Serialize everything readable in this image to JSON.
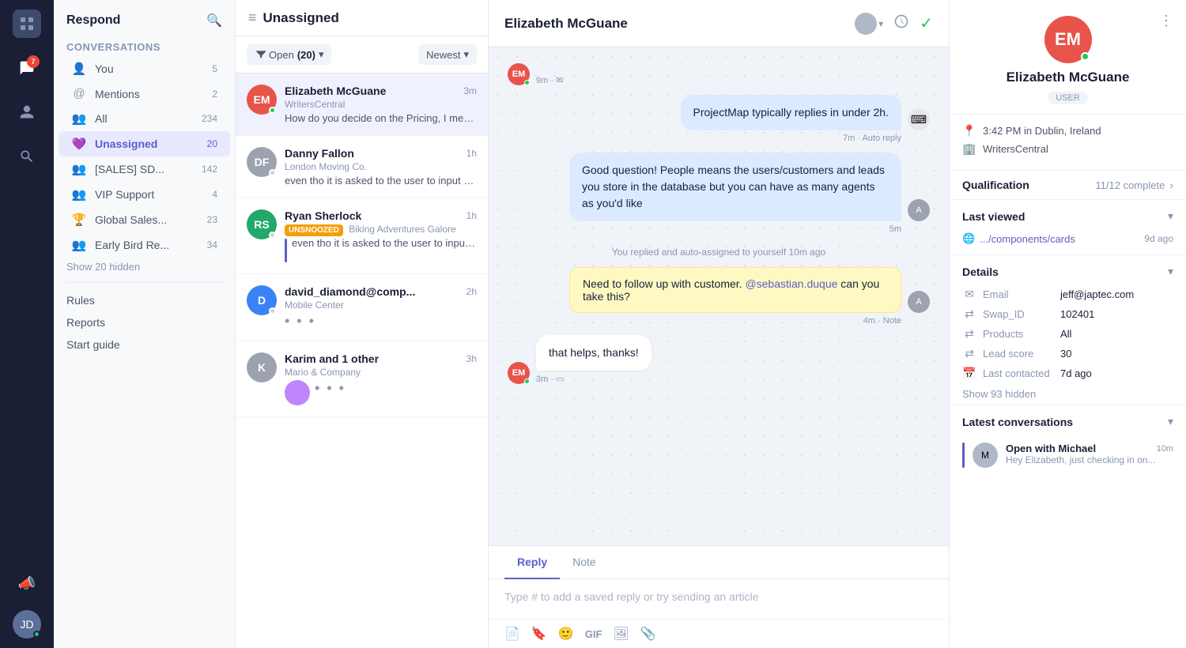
{
  "app": {
    "title": "Respond"
  },
  "leftNav": {
    "logo_icon": "⊞",
    "items": [
      {
        "id": "home",
        "icon": "⊞",
        "label": "Home"
      },
      {
        "id": "conversations",
        "icon": "💬",
        "label": "Conversations",
        "active": true
      },
      {
        "id": "contacts",
        "icon": "👤",
        "label": "Contacts"
      },
      {
        "id": "reports",
        "icon": "🔍",
        "label": "Reports"
      }
    ],
    "badge_count": "7",
    "bottom": {
      "megaphone_icon": "📣",
      "avatar_initials": "JD"
    }
  },
  "sidebar": {
    "title": "Respond",
    "section_label": "Conversations",
    "items": [
      {
        "id": "you",
        "icon": "👤",
        "label": "You",
        "count": "5"
      },
      {
        "id": "mentions",
        "icon": "@",
        "label": "Mentions",
        "count": "2"
      },
      {
        "id": "all",
        "icon": "👥",
        "label": "All",
        "count": "234"
      },
      {
        "id": "unassigned",
        "icon": "💜",
        "label": "Unassigned",
        "count": "20",
        "active": true
      },
      {
        "id": "sales",
        "icon": "👥",
        "label": "[SALES] SD...",
        "count": "142"
      },
      {
        "id": "vip",
        "icon": "👥",
        "label": "VIP Support",
        "count": "4"
      },
      {
        "id": "global",
        "icon": "🏆",
        "label": "Global Sales...",
        "count": "23"
      },
      {
        "id": "earlybird",
        "icon": "👥",
        "label": "Early Bird Re...",
        "count": "34"
      }
    ],
    "show_hidden": "Show 20 hidden",
    "links": [
      {
        "id": "rules",
        "label": "Rules"
      },
      {
        "id": "reports",
        "label": "Reports"
      },
      {
        "id": "start_guide",
        "label": "Start guide"
      }
    ]
  },
  "convList": {
    "title": "Unassigned",
    "filter": {
      "status": "Open",
      "count": "20",
      "sort": "Newest"
    },
    "items": [
      {
        "id": "em",
        "initials": "EM",
        "bg_color": "#e8534a",
        "name": "Elizabeth McGuane",
        "sub": "WritersCentral",
        "preview": "How do you decide on the Pricing, I mean what is your definition of People? When...",
        "time": "3m",
        "online": true,
        "active": true
      },
      {
        "id": "df",
        "initials": "DF",
        "bg_color": "#8896b3",
        "name": "Danny Fallon",
        "sub": "London Moving Co.",
        "preview": "even tho it is asked to the user to input on one line, can we show more lines of text...",
        "time": "1h",
        "online": false,
        "active": false
      },
      {
        "id": "rs",
        "initials": "RS",
        "bg_color": "#22a869",
        "name": "Ryan Sherlock",
        "sub": "Biking Adventures Galore",
        "preview": "even tho it is asked to the user to input on one line, can we show...",
        "time": "1h",
        "badge": "UNSNOOZED",
        "online": false,
        "active": false
      },
      {
        "id": "dd",
        "initials": "D",
        "bg_color": "#3b82f6",
        "name": "david_diamond@comp...",
        "sub": "Mobile Center",
        "preview": "···",
        "time": "2h",
        "typing": true,
        "online": false,
        "active": false
      },
      {
        "id": "ko",
        "initials": "K",
        "bg_color": "#8896b3",
        "name": "Karim and 1 other",
        "sub": "Mario & Company",
        "preview": "···",
        "time": "3h",
        "typing": true,
        "online": false,
        "active": false
      }
    ]
  },
  "chat": {
    "contact_name": "Elizabeth McGuane",
    "messages": [
      {
        "id": "msg1",
        "type": "received",
        "avatar_initials": "EM",
        "avatar_bg": "#e8534a",
        "time": "9m",
        "icon": "✉"
      },
      {
        "id": "msg2",
        "type": "system_reply",
        "text": "ProjectMap typically replies in under 2h.",
        "time": "7m",
        "meta": "Auto reply"
      },
      {
        "id": "msg3",
        "type": "sent",
        "text": "Good question! People means the users/customers and leads you store in the database but you can have as many agents as you'd like",
        "time": "5m",
        "avatar_bg": "#8896b3"
      },
      {
        "id": "msg4",
        "type": "system_event",
        "text": "You replied and auto-assigned to yourself 10m ago"
      },
      {
        "id": "msg5",
        "type": "note",
        "text_before": "Need to follow up with customer. ",
        "mention": "@sebastian.duque",
        "text_after": " can you take this?",
        "time": "4m",
        "meta": "Note",
        "avatar_bg": "#8896b3"
      },
      {
        "id": "msg6",
        "type": "received",
        "avatar_initials": "EM",
        "avatar_bg": "#e8534a",
        "text": "that helps, thanks!",
        "time": "3m",
        "icon": "▭",
        "online": true
      }
    ],
    "reply_tabs": [
      {
        "id": "reply",
        "label": "Reply",
        "active": true
      },
      {
        "id": "note",
        "label": "Note",
        "active": false
      }
    ],
    "reply_placeholder": "Type # to add a saved reply or try sending an article",
    "toolbar_tools": [
      "📄",
      "🔖",
      "🙂",
      "GIF",
      "🖼",
      "📎"
    ]
  },
  "rightPanel": {
    "avatar_initials": "EM",
    "avatar_bg": "#e8534a",
    "name": "Elizabeth McGuane",
    "badge": "USER",
    "location": "3:42 PM in Dublin, Ireland",
    "company": "WritersCentral",
    "qualification": {
      "label": "Qualification",
      "value": "11/12 complete"
    },
    "last_viewed": {
      "label": "Last viewed",
      "url": ".../components/cards",
      "time": "9d ago"
    },
    "details": {
      "label": "Details",
      "items": [
        {
          "icon": "✉",
          "label": "Email",
          "value": "jeff@japtec.com"
        },
        {
          "icon": "⇄",
          "label": "Swap_ID",
          "value": "102401"
        },
        {
          "icon": "⇄",
          "label": "Products",
          "value": "All"
        },
        {
          "icon": "⇄",
          "label": "Lead score",
          "value": "30"
        },
        {
          "icon": "📅",
          "label": "Last contacted",
          "value": "7d ago"
        }
      ],
      "show_hidden": "Show 93 hidden"
    },
    "latest_conversations": {
      "label": "Latest conversations",
      "items": [
        {
          "id": "lc1",
          "avatar_text": "M",
          "avatar_bg": "#8896b3",
          "name": "Open with Michael",
          "time": "10m",
          "preview": "Hey Elizabeth, just checking in on...",
          "bar_color": "#5b5fc7"
        }
      ]
    }
  }
}
